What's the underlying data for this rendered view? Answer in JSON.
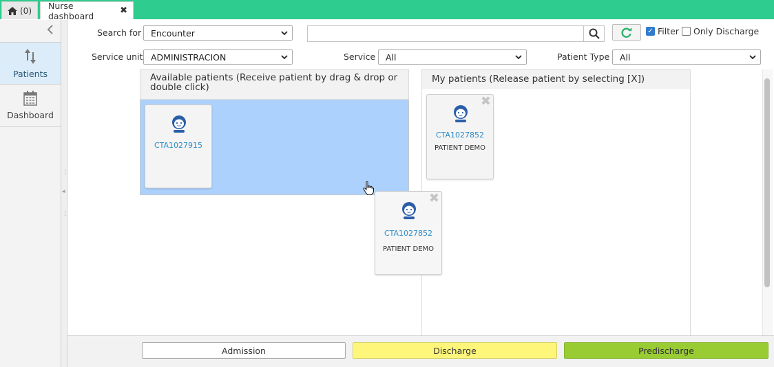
{
  "tabs": {
    "home_label": "(0)",
    "active_label": "Nurse dashboard",
    "close_glyph": "✖"
  },
  "sidebar": {
    "items": [
      {
        "label": "Patients",
        "icon": "sort-arrows-icon",
        "active": true
      },
      {
        "label": "Dashboard",
        "icon": "calendar-icon",
        "active": false
      }
    ]
  },
  "toolbar": {
    "search_for_label": "Search for",
    "search_for_value": "Encounter",
    "search_value": "",
    "filter_label": "Filter",
    "filter_checked": true,
    "only_discharge_label": "Only Discharge",
    "only_discharge_checked": false,
    "service_unit_label": "Service unit",
    "service_unit_value": "ADMINISTRACION",
    "service_label": "Service",
    "service_value": "All",
    "patient_type_label": "Patient Type",
    "patient_type_value": "All"
  },
  "available": {
    "header": "Available patients (Receive patient by drag & drop or double click)",
    "patients": [
      {
        "id": "CTA1027915",
        "name": ""
      }
    ]
  },
  "my_patients": {
    "header": "My patients (Release patient by selecting [X])",
    "patients": [
      {
        "id": "CTA1027852",
        "name": "PATIENT DEMO"
      }
    ]
  },
  "dragging_card": {
    "id": "CTA1027852",
    "name": "PATIENT DEMO"
  },
  "actions": {
    "admission": "Admission",
    "discharge": "Discharge",
    "predischarge": "Predischarge"
  },
  "colors": {
    "topbar": "#2ecc8e",
    "drop_zone": "#acd1fc",
    "discharge": "#fdf67a",
    "predischarge": "#99cc33",
    "link": "#2a8bc9"
  }
}
